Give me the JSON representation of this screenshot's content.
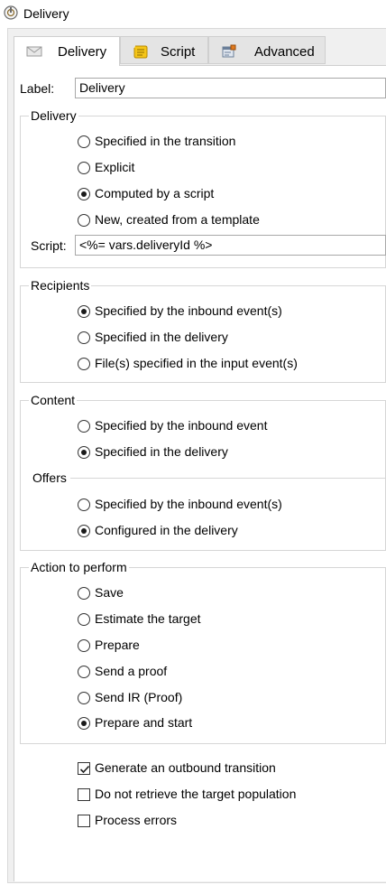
{
  "window": {
    "title": "Delivery"
  },
  "tabs": [
    {
      "label": "Delivery",
      "icon": "envelope-icon",
      "active": true
    },
    {
      "label": "Script",
      "icon": "script-icon",
      "active": false
    },
    {
      "label": "Advanced",
      "icon": "advanced-settings-icon",
      "active": false
    }
  ],
  "label_field": {
    "label": "Label:",
    "value": "Delivery"
  },
  "delivery_group": {
    "title": "Delivery",
    "options": [
      {
        "label": "Specified in the transition",
        "selected": false
      },
      {
        "label": "Explicit",
        "selected": false
      },
      {
        "label": "Computed by a script",
        "selected": true
      },
      {
        "label": "New, created from a template",
        "selected": false
      }
    ],
    "script_label": "Script:",
    "script_value": "<%= vars.deliveryId %>"
  },
  "recipients_group": {
    "title": "Recipients",
    "options": [
      {
        "label": "Specified by the inbound event(s)",
        "selected": true
      },
      {
        "label": "Specified in the delivery",
        "selected": false
      },
      {
        "label": "File(s) specified in the input event(s)",
        "selected": false
      }
    ]
  },
  "content_group": {
    "title": "Content",
    "options": [
      {
        "label": "Specified by the inbound event",
        "selected": false
      },
      {
        "label": "Specified in the delivery",
        "selected": true
      }
    ],
    "offers_title": "Offers",
    "offers_options": [
      {
        "label": "Specified by the inbound event(s)",
        "selected": false
      },
      {
        "label": "Configured in the delivery",
        "selected": true
      }
    ]
  },
  "action_group": {
    "title": "Action to perform",
    "options": [
      {
        "label": "Save",
        "selected": false
      },
      {
        "label": "Estimate the target",
        "selected": false
      },
      {
        "label": "Prepare",
        "selected": false
      },
      {
        "label": "Send a proof",
        "selected": false
      },
      {
        "label": "Send IR (Proof)",
        "selected": false
      },
      {
        "label": "Prepare and start",
        "selected": true
      }
    ]
  },
  "checkboxes": [
    {
      "label": "Generate an outbound transition",
      "checked": true
    },
    {
      "label": "Do not retrieve the target population",
      "checked": false
    },
    {
      "label": "Process errors",
      "checked": false
    }
  ]
}
